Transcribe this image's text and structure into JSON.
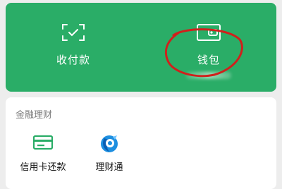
{
  "top_card": {
    "pay_label": "收付款",
    "wallet_label": "钱包",
    "pay_icon": "scan-check-icon",
    "wallet_icon": "wallet-icon",
    "background": "#2aad67"
  },
  "annotation": {
    "color": "#d0201c"
  },
  "finance": {
    "title": "金融理财",
    "items": [
      {
        "label": "信用卡还款",
        "icon": "credit-card-icon"
      },
      {
        "label": "理财通",
        "icon": "licaitong-icon"
      }
    ]
  }
}
